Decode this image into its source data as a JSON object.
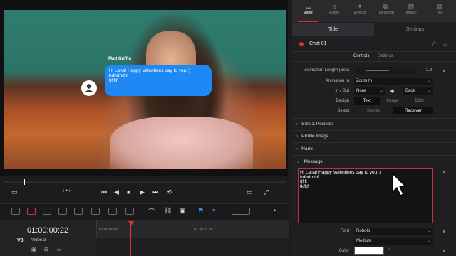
{
  "viewer": {
    "sender_name": "Matt Griffin",
    "message_lines": [
      "Hi Lana! Happy Valentines day to you :)",
      "hdhdhdhf",
      "fjfjfjf"
    ]
  },
  "transport": {
    "buttons": [
      "skip-back",
      "step-back",
      "stop",
      "play",
      "step-forward",
      "loop"
    ]
  },
  "timeline": {
    "timecode": "01:00:00:22",
    "ruler_labels": [
      "01:00:00:00",
      "01:00:02:00"
    ],
    "track_id": "V3",
    "track_name": "Video 3"
  },
  "inspector": {
    "top_tabs": [
      {
        "label": "Video",
        "icon": "video-icon",
        "active": true
      },
      {
        "label": "Audio",
        "icon": "audio-icon",
        "active": false
      },
      {
        "label": "Effects",
        "icon": "effects-icon",
        "active": false
      },
      {
        "label": "Transition",
        "icon": "transition-icon",
        "active": false
      },
      {
        "label": "Image",
        "icon": "image-icon",
        "active": false
      },
      {
        "label": "File",
        "icon": "file-icon",
        "active": false
      }
    ],
    "sub_tabs": {
      "title": "Title",
      "settings": "Settings"
    },
    "chat_title": "Chat 01",
    "content_tabs": {
      "controls": "Controls",
      "settings": "Settings"
    },
    "animation_length_label": "Animation Length (Sec)",
    "animation_length_value": "1.0",
    "animation_length_fraction": 0.5,
    "animation_in_label": "Animation In",
    "animation_in_value": "Zoom In",
    "in_out_label": "In / Out",
    "in_value": "None",
    "out_value": "Back",
    "design_label": "Design",
    "design_options": [
      "Text",
      "Image",
      "Both"
    ],
    "design_selected": "Text",
    "select_label": "Select",
    "select_options": [
      "Sender",
      "Receiver"
    ],
    "select_selected": "Receiver",
    "sections": [
      "Size & Position",
      "Profile Image",
      "Name",
      "Message"
    ],
    "message_text": [
      "Hi Lana! Happy Valentines day to you :)",
      "hdhdhdhf",
      "fjfjfj",
      "fkfkf"
    ],
    "font_label": "Font",
    "font_value": "Roboto",
    "font_style_value": "Medium",
    "color_label": "Color",
    "color_value": "#FFFFFF",
    "accent": "#E0303A",
    "bubble_color": "#1E88F5"
  }
}
